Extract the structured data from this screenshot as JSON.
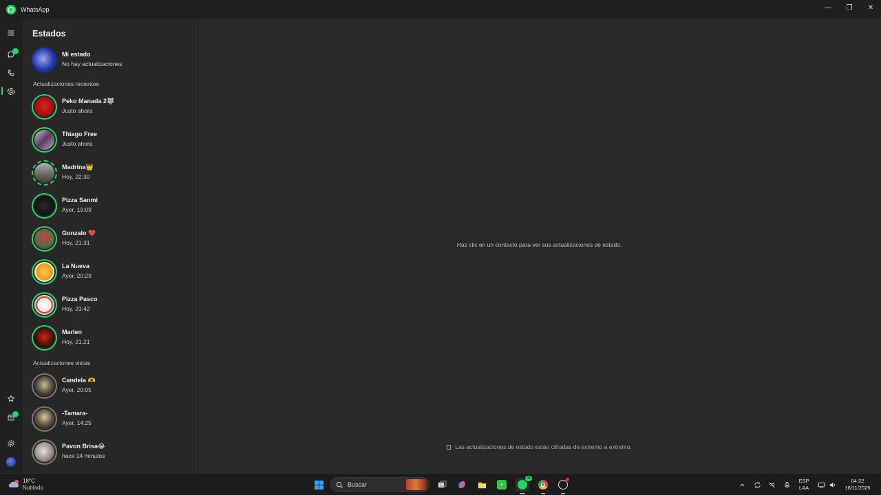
{
  "titlebar": {
    "app_title": "WhatsApp",
    "minimize": "—",
    "maximize": "❐",
    "close": "✕"
  },
  "rail": {
    "icons": [
      "menu-icon",
      "chats-icon",
      "calls-icon",
      "status-icon",
      "starred-icon",
      "archived-icon",
      "settings-icon",
      "profile-avatar"
    ]
  },
  "status_panel": {
    "title": "Estados",
    "my_status": {
      "name": "Mi estado",
      "subtitle": "No hay actualizaciones"
    },
    "recent_label": "Actualizaciones recientes",
    "recent": [
      {
        "name": "Peko Manada 2🐺",
        "time": "Justo ahora"
      },
      {
        "name": "Thiago Free",
        "time": "Justo ahora"
      },
      {
        "name": "Madrina👑",
        "time": "Hoy, 22:30"
      },
      {
        "name": "Pizza Sanmi",
        "time": "Ayer, 19:09"
      },
      {
        "name": "Gonzalo ❤️",
        "time": "Hoy, 21:31"
      },
      {
        "name": "La Nueva",
        "time": "Ayer, 20:29"
      },
      {
        "name": "Pizza Pasco",
        "time": "Hoy, 23:42"
      },
      {
        "name": "Marlen",
        "time": "Hoy, 21:21"
      }
    ],
    "viewed_label": "Actualizaciones vistas",
    "viewed": [
      {
        "name": "Candela 🫶",
        "time": "Ayer, 20:05"
      },
      {
        "name": "-Tamara-",
        "time": "Ayer, 14:25"
      },
      {
        "name": "Pavon Brisa😂",
        "time": "hace 14 minutos"
      }
    ]
  },
  "main": {
    "hint": "Haz clic en un contacto para ver sus actualizaciones de estado.",
    "encryption_note": "Las actualizaciones de estado están cifradas de extremo a extremo."
  },
  "taskbar": {
    "weather_temp": "18°C",
    "weather_desc": "Nublado",
    "search_label": "Buscar",
    "whatsapp_badge": "46",
    "language_top": "ESP",
    "language_bottom": "LAA",
    "clock_time": "04:22",
    "clock_date": "16/11/2025"
  },
  "colors": {
    "accent": "#25d366",
    "panel": "#272727",
    "main": "#292929",
    "rail": "#202020"
  }
}
